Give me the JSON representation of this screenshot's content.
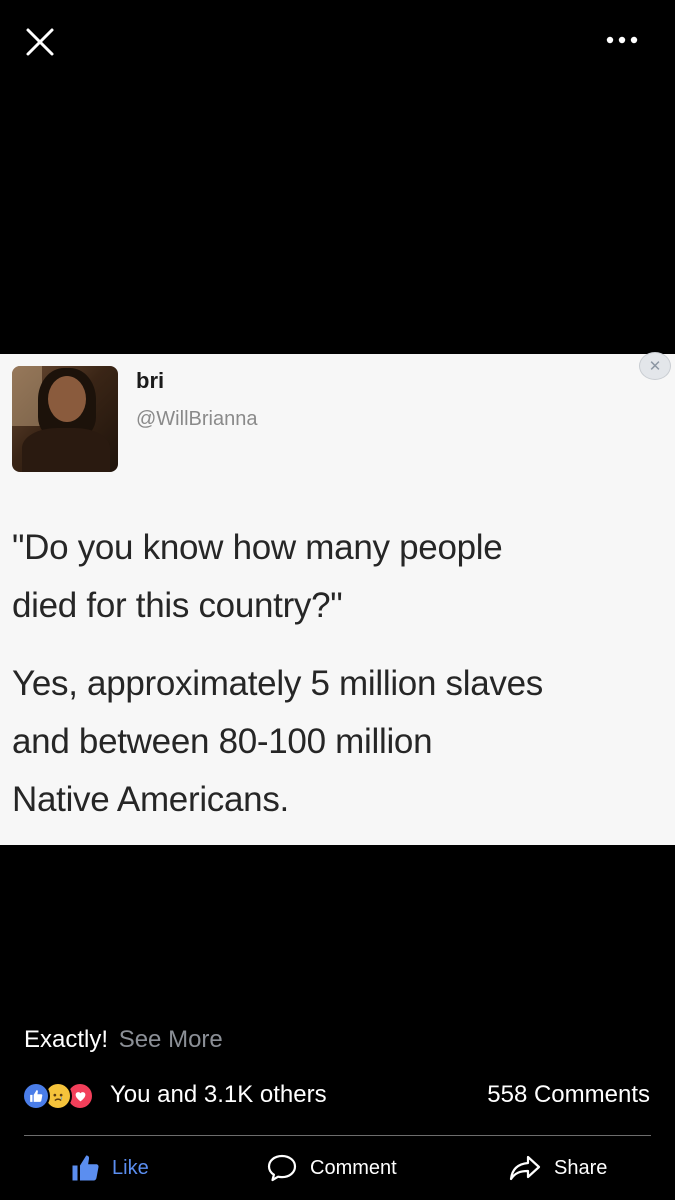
{
  "viewer": {
    "close_icon": "close-icon",
    "more_icon": "more-dots-icon"
  },
  "tweet": {
    "name": "bri",
    "handle": "@WillBrianna",
    "lines": [
      "\"Do you know how many people",
      "died for this country?\"",
      "Yes, approximately 5 million slaves",
      "and between 80-100 million",
      "Native Americans."
    ]
  },
  "post": {
    "caption": "Exactly!",
    "see_more": "See More",
    "reactions_text": "You and 3.1K others",
    "comments_count": "558 Comments"
  },
  "actions": {
    "like": "Like",
    "comment": "Comment",
    "share": "Share"
  },
  "colors": {
    "background": "#000000",
    "like_blue": "#5b8ef0",
    "love_red": "#f23f5a",
    "sad_yellow": "#f5c33b",
    "muted_text": "#8b8f96"
  }
}
